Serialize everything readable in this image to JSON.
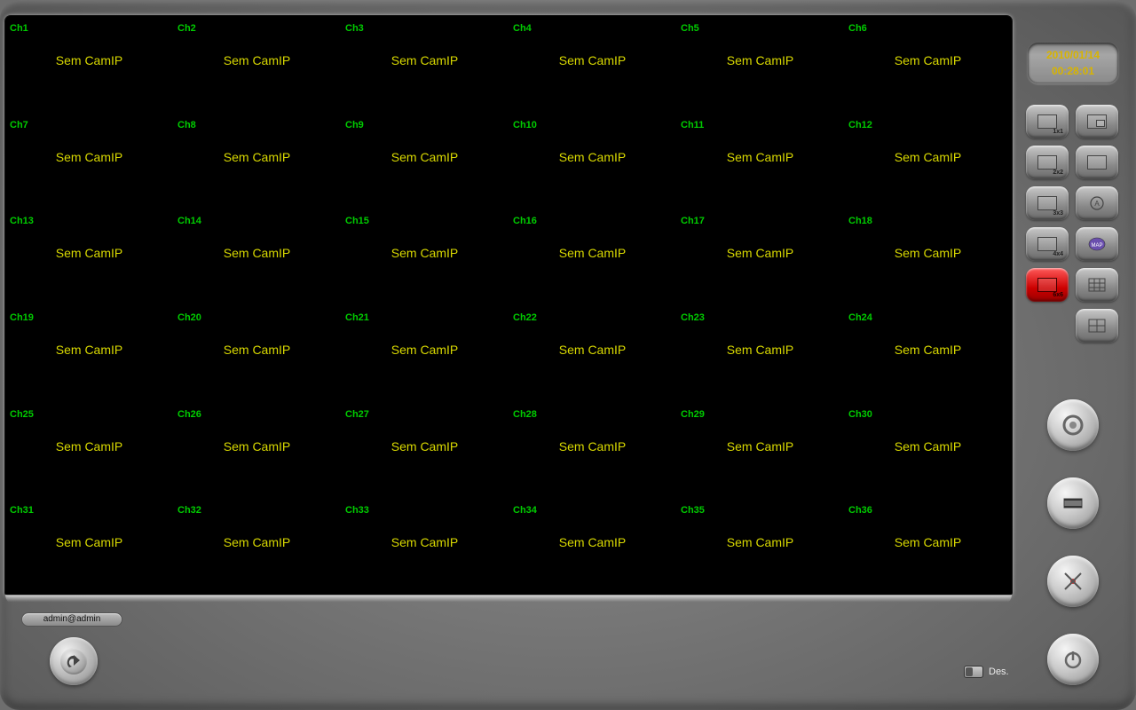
{
  "datetime": {
    "date": "2010/01/14",
    "time": "00:28:01"
  },
  "user": "admin@admin",
  "des_label": "Des.",
  "camera_status": "Sem CamIP",
  "channels": [
    "Ch1",
    "Ch2",
    "Ch3",
    "Ch4",
    "Ch5",
    "Ch6",
    "Ch7",
    "Ch8",
    "Ch9",
    "Ch10",
    "Ch11",
    "Ch12",
    "Ch13",
    "Ch14",
    "Ch15",
    "Ch16",
    "Ch17",
    "Ch18",
    "Ch19",
    "Ch20",
    "Ch21",
    "Ch22",
    "Ch23",
    "Ch24",
    "Ch25",
    "Ch26",
    "Ch27",
    "Ch28",
    "Ch29",
    "Ch30",
    "Ch31",
    "Ch32",
    "Ch33",
    "Ch34",
    "Ch35",
    "Ch36"
  ],
  "layouts": {
    "l1x1": "1x1",
    "l2x2": "2x2",
    "l3x3": "3x3",
    "l4x4": "4x4",
    "l6x6": "6x6",
    "map": "MAP"
  },
  "active_layout": "l6x6"
}
